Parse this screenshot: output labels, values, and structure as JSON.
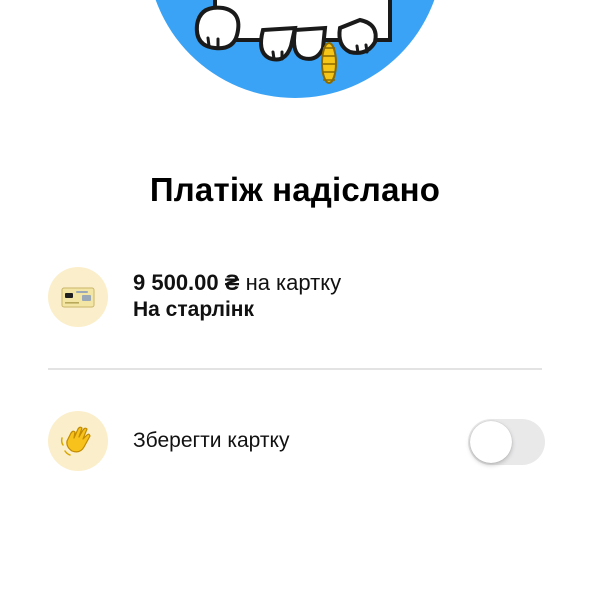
{
  "status": {
    "title": "Платіж надіслано"
  },
  "payment": {
    "amount": "9 500.00 ₴",
    "destination_text": "на картку",
    "recipient": "На старлінк",
    "icon": "card-icon"
  },
  "save_card": {
    "label": "Зберегти картку",
    "icon": "waving-hand-icon",
    "enabled": false
  },
  "colors": {
    "hero_background": "#3aa3f5",
    "icon_background": "#fbeecb",
    "divider": "#e3e3e3",
    "toggle_off": "#e9e9ea"
  }
}
